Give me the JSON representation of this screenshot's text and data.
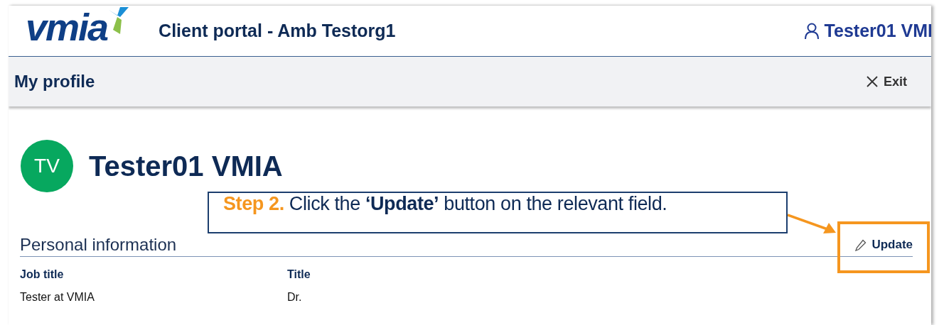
{
  "header": {
    "logo": "vmia",
    "title": "Client portal - Amb Testorg1",
    "user": "Tester01 VMI"
  },
  "page_bar": {
    "title": "My profile",
    "exit": "Exit"
  },
  "profile": {
    "initials": "TV",
    "name": "Tester01 VMIA"
  },
  "section": {
    "title": "Personal information",
    "action": "Update",
    "fields": [
      {
        "label": "Job title",
        "value": "Tester at VMIA"
      },
      {
        "label": "Title",
        "value": "Dr."
      }
    ]
  },
  "annotation": {
    "text": "**Step 2.** Click the **‘Update’** button on the relevant field."
  }
}
